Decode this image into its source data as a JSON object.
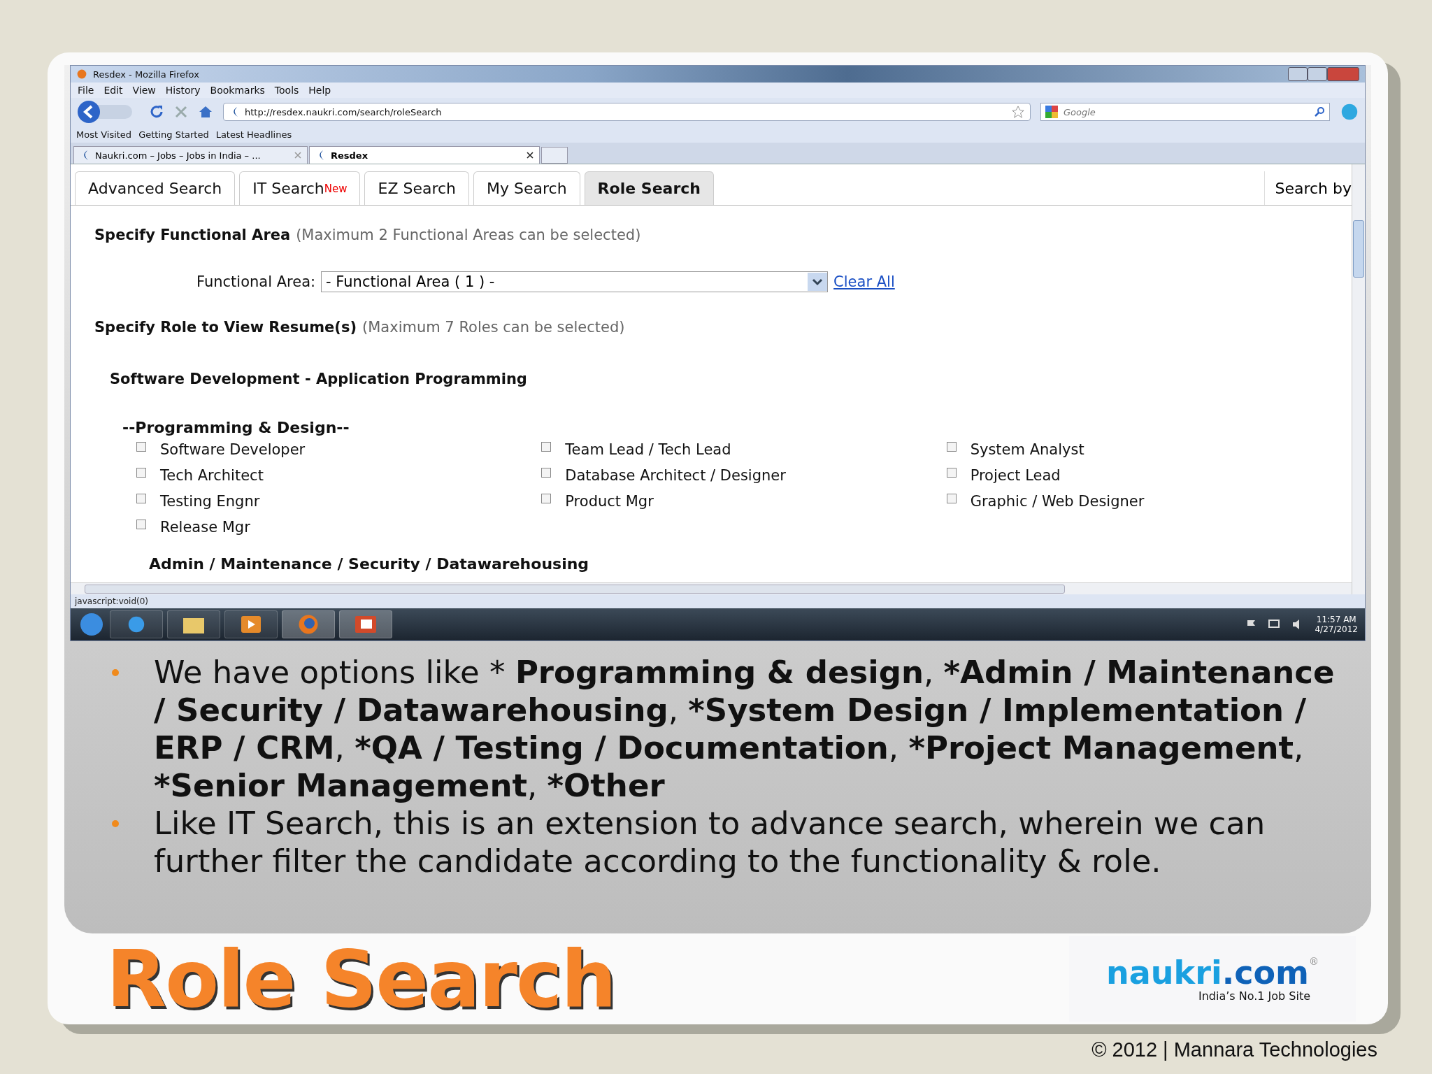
{
  "browser": {
    "title": "Resdex - Mozilla Firefox",
    "menu": [
      "File",
      "Edit",
      "View",
      "History",
      "Bookmarks",
      "Tools",
      "Help"
    ],
    "url": "http://resdex.naukri.com/search/roleSearch",
    "search_placeholder": "Google",
    "bookmarks": [
      "Most Visited",
      "Getting Started",
      "Latest Headlines"
    ],
    "tabs": [
      {
        "label": "Naukri.com – Jobs – Jobs in India – ...",
        "selected": false
      },
      {
        "label": "Resdex",
        "selected": true
      }
    ],
    "status": "javascript:void(0)"
  },
  "page": {
    "tabs": [
      {
        "label": "Advanced Search",
        "selected": false
      },
      {
        "label": "IT Search",
        "badge": "New",
        "selected": false
      },
      {
        "label": "EZ Search",
        "selected": false
      },
      {
        "label": "My Search",
        "selected": false
      },
      {
        "label": "Role Search",
        "selected": true
      }
    ],
    "side_tab": "Search by",
    "area_heading": "Specify Functional Area",
    "area_note": "(Maximum 2 Functional Areas can be selected)",
    "area_label": "Functional Area:",
    "area_value": "- Functional Area ( 1 )  -",
    "clear_link": "Clear All",
    "role_heading": "Specify Role to View Resume(s)",
    "role_note": "(Maximum 7 Roles can be selected)",
    "category": "Software Development - Application Programming",
    "group": "--Programming & Design--",
    "role_columns": [
      [
        {
          "label": "Software Developer",
          "checked": false
        },
        {
          "label": "Tech Architect",
          "checked": false
        },
        {
          "label": "Testing Engnr",
          "checked": false
        },
        {
          "label": "Release Mgr",
          "checked": false
        }
      ],
      [
        {
          "label": "Team Lead / Tech Lead",
          "checked": false
        },
        {
          "label": "Database Architect / Designer",
          "checked": false
        },
        {
          "label": "Product Mgr",
          "checked": false
        }
      ],
      [
        {
          "label": "System Analyst",
          "checked": false
        },
        {
          "label": "Project Lead",
          "checked": false
        },
        {
          "label": "Graphic / Web Designer",
          "checked": false
        }
      ]
    ],
    "next_group": "Admin / Maintenance / Security / Datawarehousing"
  },
  "taskbar": {
    "time": "11:57 AM",
    "date": "4/27/2012"
  },
  "bullets": [
    "We have options like * **Programming & design**, ***Admin / Maintenance / Security / Datawarehousing**, ***System Design / Implementation / ERP / CRM**, ***QA / Testing / Documentation**, ***Project Management**, ***Senior Management**, ***Other**",
    "Like IT Search, this is an extension to advance search, wherein we can further filter the candidate according to the functionality & role."
  ],
  "title": "Role Search",
  "logo": {
    "brand": "naukri",
    "suffix": ".com",
    "mark": "®",
    "tagline": "India’s No.1 Job Site"
  },
  "copyright": "© 2012 | Mannara Technologies"
}
